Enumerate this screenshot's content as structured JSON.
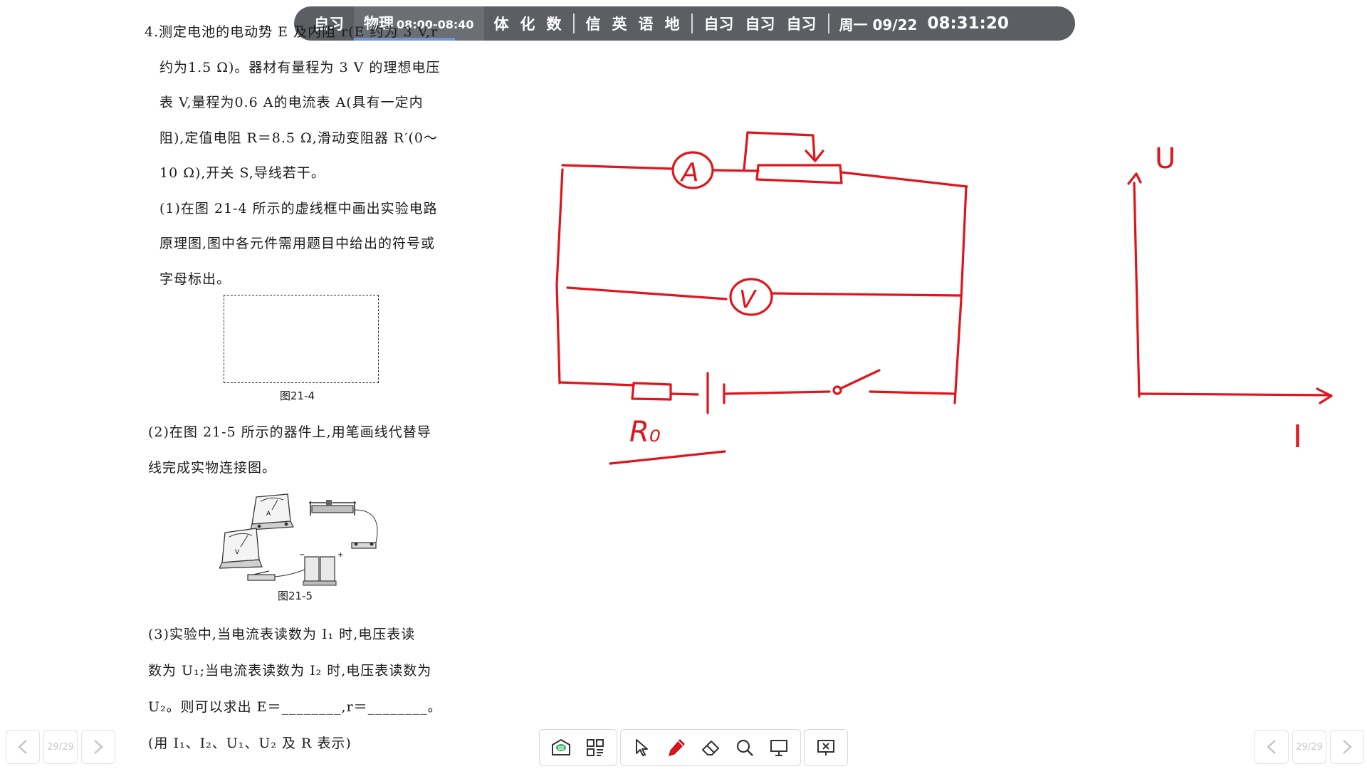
{
  "schedule": {
    "before": [
      "自习"
    ],
    "current": {
      "subject": "物理",
      "time": "08:00-08:40",
      "progress_fraction": 0.78
    },
    "group1": [
      "体",
      "化",
      "数"
    ],
    "group2": [
      "信",
      "英",
      "语",
      "地"
    ],
    "group3": [
      "自习",
      "自习",
      "自习"
    ],
    "date": "周一 09/22",
    "clock": "08:31:20"
  },
  "problem": {
    "lines": [
      "4.测定电池的电动势 E 及内阻 r(E 约为 3 V,r",
      "约为1.5 Ω)。器材有量程为 3 V 的理想电压",
      "表 V,量程为0.6 A的电流表 A(具有一定内",
      "阻),定值电阻 R＝8.5 Ω,滑动变阻器 R′(0～",
      "10 Ω),开关 S,导线若干。",
      "(1)在图 21-4 所示的虚线框中画出实验电路",
      "原理图,图中各元件需用题目中给出的符号或",
      "字母标出。"
    ],
    "fig1_caption": "图21-4",
    "part2_lines": [
      "(2)在图 21-5 所示的器件上,用笔画线代替导",
      "线完成实物连接图。"
    ],
    "fig2_caption": "图21-5",
    "fig2_labels": {
      "ammeter": "A",
      "voltmeter": "V",
      "minus": "−",
      "plus": "+"
    },
    "part3_lines": [
      "(3)实验中,当电流表读数为 I₁ 时,电压表读",
      "数为 U₁;当电流表读数为 I₂ 时,电压表读数为",
      "U₂。则可以求出 E＝________,r＝________。",
      "(用 I₁、I₂、U₁、U₂ 及 R 表示)"
    ]
  },
  "annotations": {
    "ammeter": "A",
    "voltmeter": "V",
    "resistor": "R₀",
    "y_axis": "U",
    "x_axis": "I",
    "ink_color": "#e0141a"
  },
  "navigation": {
    "page_left": "29/29",
    "page_right": "29/29"
  },
  "toolbar": {
    "icons": [
      "board-icon",
      "grid-icon",
      "select-icon",
      "pen-icon",
      "eraser-icon",
      "search-icon",
      "screen-icon",
      "close-board-icon"
    ]
  }
}
